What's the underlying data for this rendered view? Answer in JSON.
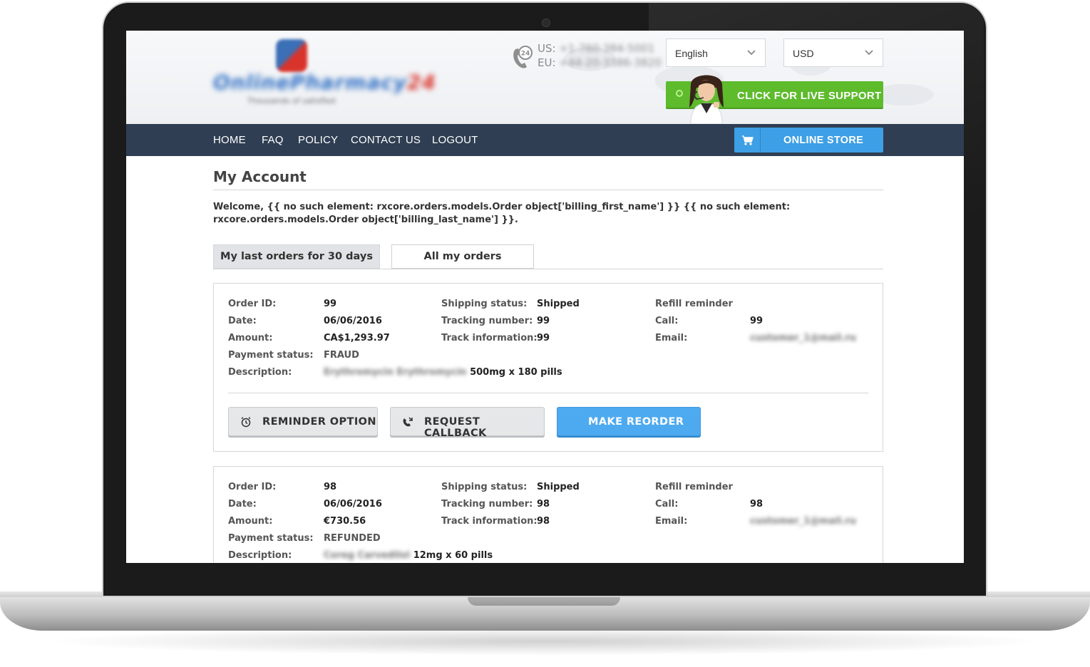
{
  "header": {
    "phone": {
      "us_label": "US:",
      "eu_label": "EU:",
      "us_number": "+1-760-384-5001",
      "eu_number": "+44-20-3386-3820"
    },
    "language_select": {
      "value": "English"
    },
    "currency_select": {
      "value": "USD"
    },
    "support_button": "CLICK FOR LIVE SUPPORT"
  },
  "nav": {
    "items": [
      "HOME",
      "FAQ",
      "POLICY",
      "CONTACT US",
      "LOGOUT"
    ],
    "store_button": "ONLINE STORE"
  },
  "page": {
    "title": "My Account",
    "welcome": "Welcome, {{ no such element: rxcore.orders.models.Order object['billing_first_name'] }} {{ no such element: rxcore.orders.models.Order object['billing_last_name'] }}."
  },
  "tabs": [
    {
      "label": "My last orders for 30 days",
      "active": true
    },
    {
      "label": "All my orders",
      "active": false
    }
  ],
  "labels": {
    "order_id": "Order ID:",
    "date": "Date:",
    "amount": "Amount:",
    "payment_status": "Payment status:",
    "description": "Description:",
    "shipping_status": "Shipping status:",
    "tracking_number": "Tracking number:",
    "track_information": "Track information:",
    "refill_reminder": "Refill reminder",
    "call": "Call:",
    "email": "Email:"
  },
  "buttons": {
    "reminder": "REMINDER OPTION",
    "callback": "REQUEST CALLBACK",
    "reorder": "MAKE REORDER"
  },
  "orders": [
    {
      "order_id": "99",
      "date": "06/06/2016",
      "amount": "CA$1,293.97",
      "payment_status": "FRAUD",
      "description_name": "Erythromycin Erythromycin",
      "description_detail": "500mg x 180 pills",
      "shipping_status": "Shipped",
      "tracking_number": "99",
      "track_information": "99",
      "call": "99",
      "email": "customer_1@mail.ru"
    },
    {
      "order_id": "98",
      "date": "06/06/2016",
      "amount": "€730.56",
      "payment_status": "REFUNDED",
      "description_name": "Coreg Carvedilol",
      "description_detail": "12mg x 60 pills",
      "shipping_status": "Shipped",
      "tracking_number": "98",
      "track_information": "98",
      "call": "98",
      "email": "customer_1@mail.ru"
    }
  ],
  "colors": {
    "nav_bg": "#2f3e52",
    "support_green": "#5dbb2c",
    "store_blue": "#3d9fe5",
    "reorder_blue": "#4eaaf0"
  }
}
